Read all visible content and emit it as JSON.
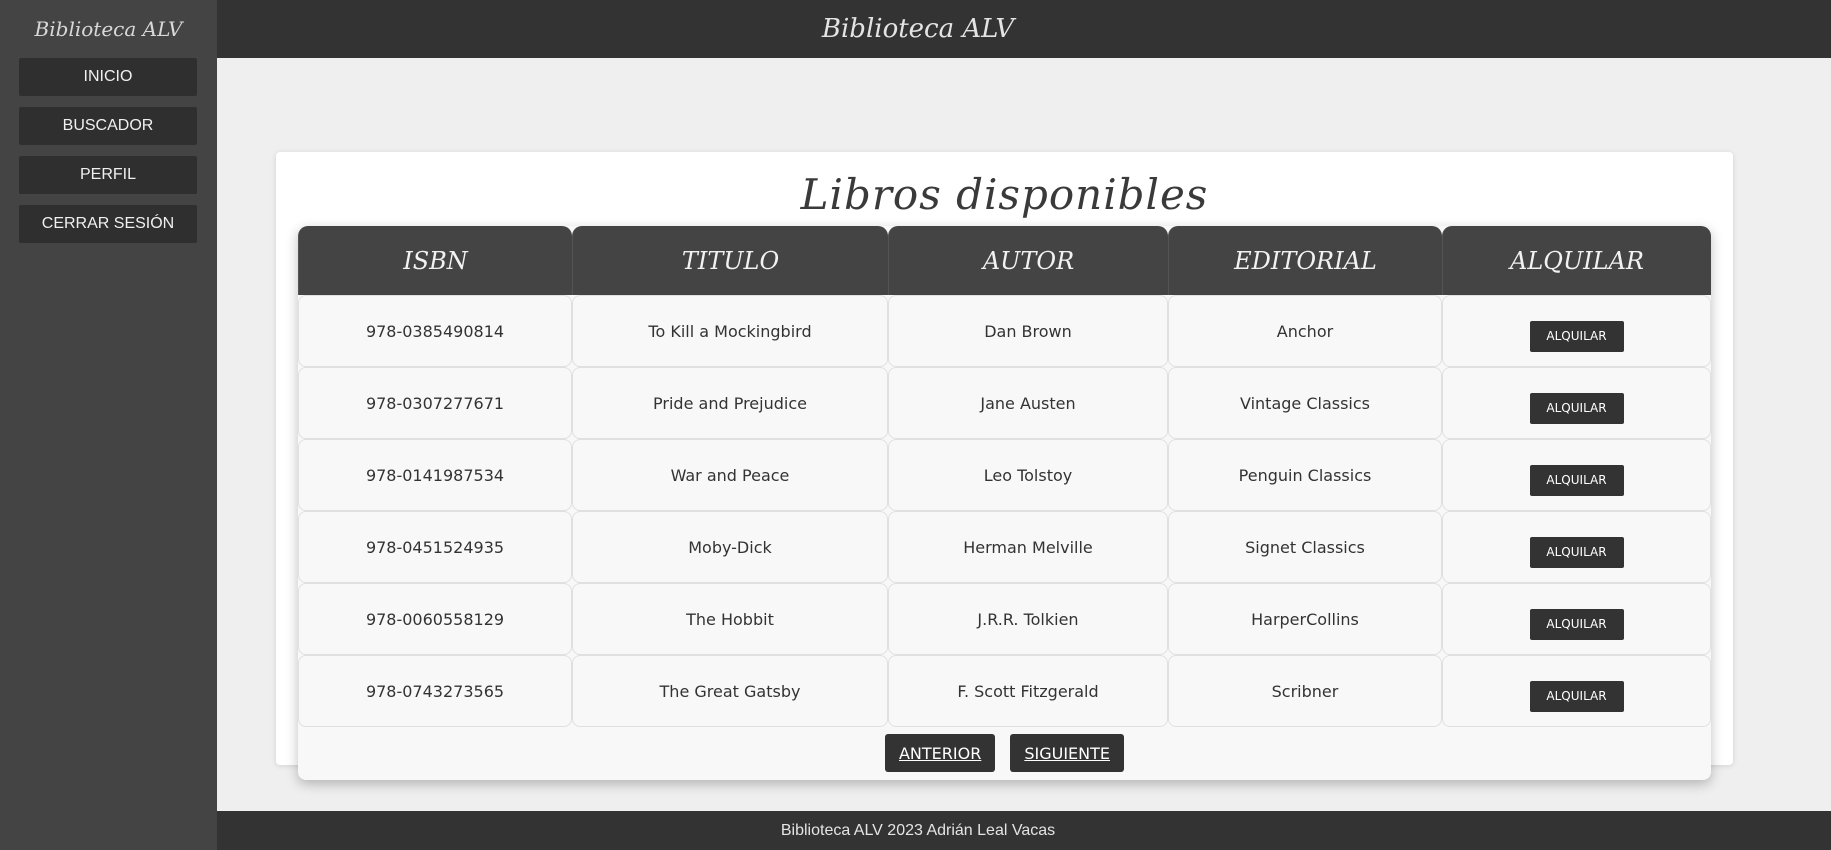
{
  "sidebar": {
    "title": "Biblioteca ALV",
    "items": [
      {
        "label": "INICIO"
      },
      {
        "label": "BUSCADOR"
      },
      {
        "label": "PERFIL"
      },
      {
        "label": "CERRAR SESIÓN"
      }
    ]
  },
  "header": {
    "title": "Biblioteca ALV"
  },
  "main": {
    "title": "Libros disponibles",
    "columns": [
      "ISBN",
      "TITULO",
      "AUTOR",
      "EDITORIAL",
      "ALQUILAR"
    ],
    "rows": [
      {
        "isbn": "978-0385490814",
        "title": "To Kill a Mockingbird",
        "author": "Dan Brown",
        "publisher": "Anchor",
        "action": "ALQUILAR"
      },
      {
        "isbn": "978-0307277671",
        "title": "Pride and Prejudice",
        "author": "Jane Austen",
        "publisher": "Vintage Classics",
        "action": "ALQUILAR"
      },
      {
        "isbn": "978-0141987534",
        "title": "War and Peace",
        "author": "Leo Tolstoy",
        "publisher": "Penguin Classics",
        "action": "ALQUILAR"
      },
      {
        "isbn": "978-0451524935",
        "title": "Moby-Dick",
        "author": "Herman Melville",
        "publisher": "Signet Classics",
        "action": "ALQUILAR"
      },
      {
        "isbn": "978-0060558129",
        "title": "The Hobbit",
        "author": "J.R.R. Tolkien",
        "publisher": "HarperCollins",
        "action": "ALQUILAR"
      },
      {
        "isbn": "978-0743273565",
        "title": "The Great Gatsby",
        "author": "F. Scott Fitzgerald",
        "publisher": "Scribner",
        "action": "ALQUILAR"
      }
    ],
    "pagination": {
      "prev_label": "ANTERIOR",
      "next_label": "SIGUIENTE"
    }
  },
  "footer": {
    "text": "Biblioteca ALV 2023 Adrián Leal Vacas"
  },
  "colors": {
    "sidebar": "#444444",
    "header": "#333333",
    "button": "#2f2f2f",
    "background": "#efefef"
  }
}
